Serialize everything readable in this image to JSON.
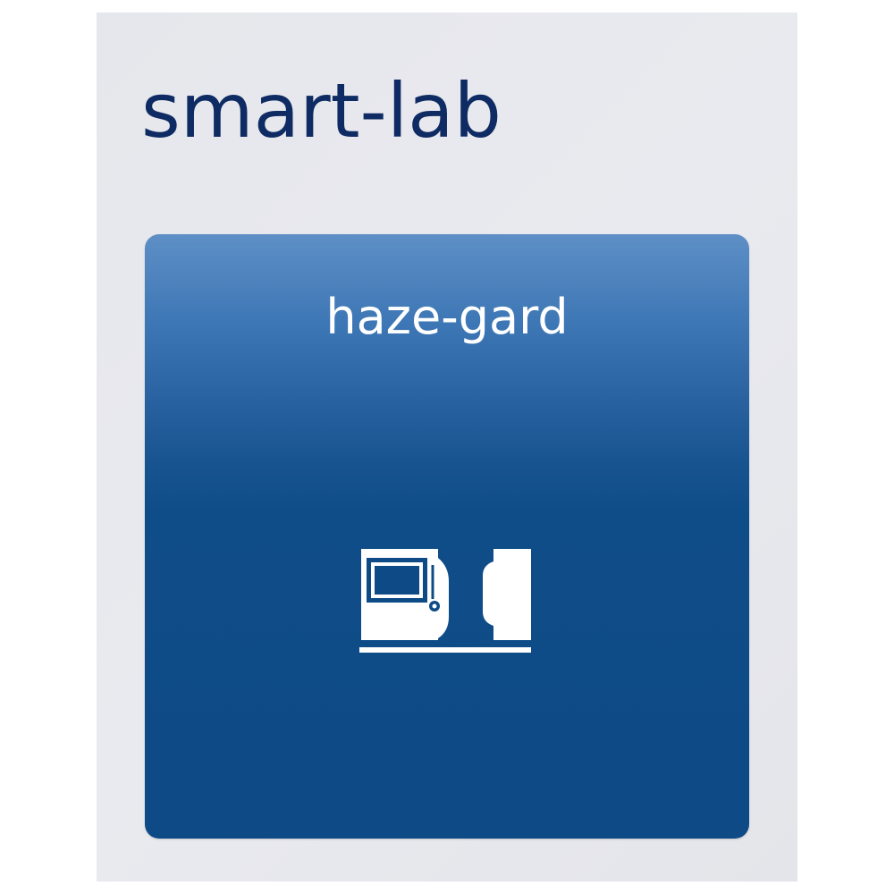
{
  "header": {
    "title": "smart-lab"
  },
  "tile": {
    "label": "haze-gard",
    "icon": "haze-meter-device-icon",
    "background_color": "#0e4a85",
    "gradient_top_color": "#5e8fc6"
  },
  "colors": {
    "title": "#0f2b63",
    "panel_background": "#e6e7ec",
    "tile_text": "#ffffff"
  }
}
